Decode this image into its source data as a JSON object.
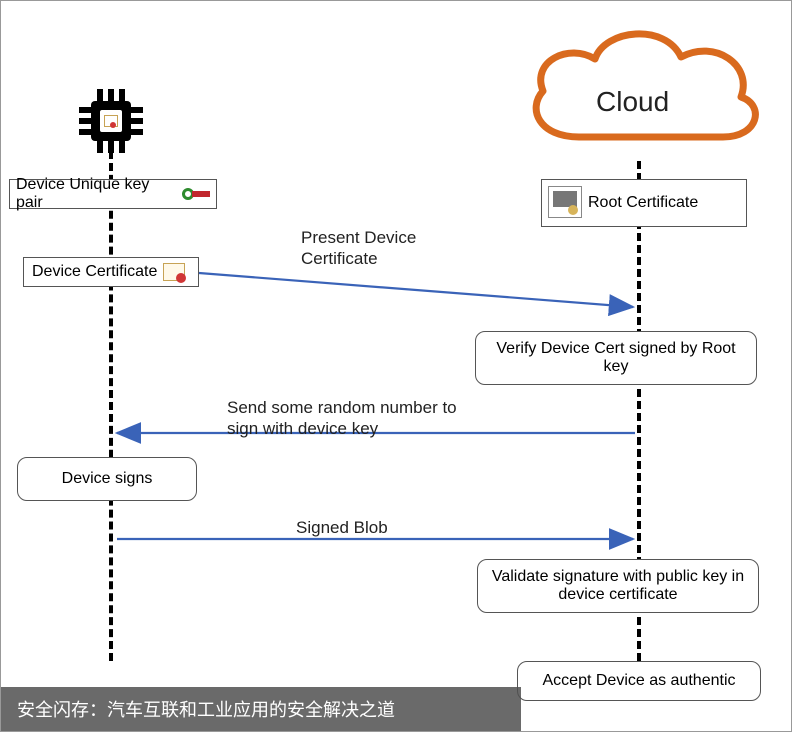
{
  "diagram": {
    "cloud_label": "Cloud",
    "device": {
      "keypair_label": "Device Unique key pair",
      "cert_label": "Device Certificate",
      "signs_label": "Device signs"
    },
    "server": {
      "root_cert_label": "Root Certificate",
      "verify_label": "Verify Device Cert signed by Root key",
      "validate_label": "Validate signature with public key in device certificate",
      "accept_label": "Accept Device as authentic"
    },
    "messages": {
      "present": "Present Device Certificate",
      "random": "Send some random number to sign with device key",
      "signed": "Signed Blob"
    },
    "footer": "安全闪存：汽车互联和工业应用的安全解决之道"
  },
  "chart_data": {
    "type": "sequence-diagram",
    "participants": [
      "Device",
      "Cloud"
    ],
    "steps": [
      {
        "from": "Device",
        "to": "Cloud",
        "label": "Present Device Certificate"
      },
      {
        "at": "Cloud",
        "action": "Verify Device Cert signed by Root key"
      },
      {
        "from": "Cloud",
        "to": "Device",
        "label": "Send some random number to sign with device key"
      },
      {
        "at": "Device",
        "action": "Device signs"
      },
      {
        "from": "Device",
        "to": "Cloud",
        "label": "Signed Blob"
      },
      {
        "at": "Cloud",
        "action": "Validate signature with public key in device certificate"
      },
      {
        "at": "Cloud",
        "action": "Accept Device as authentic"
      }
    ],
    "device_assets": [
      "Device Unique key pair",
      "Device Certificate"
    ],
    "cloud_assets": [
      "Root Certificate"
    ]
  }
}
